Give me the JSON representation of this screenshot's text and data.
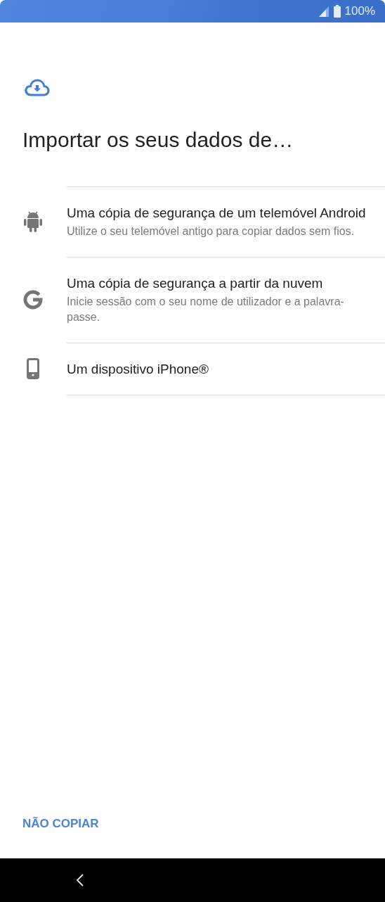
{
  "status_bar": {
    "battery": "100%"
  },
  "title": "Importar os seus dados de…",
  "options": [
    {
      "kind": "android",
      "title": "Uma cópia de segurança de um telemóvel Android",
      "subtitle": "Utilize o seu telemóvel antigo para copiar dados sem fios."
    },
    {
      "kind": "google",
      "title": "Uma cópia de segurança a partir da nuvem",
      "subtitle": "Inicie sessão com o seu nome de utilizador e a palavra-passe."
    },
    {
      "kind": "phone",
      "title": "Um dispositivo iPhone®"
    }
  ],
  "skip_button": "NÃO COPIAR"
}
